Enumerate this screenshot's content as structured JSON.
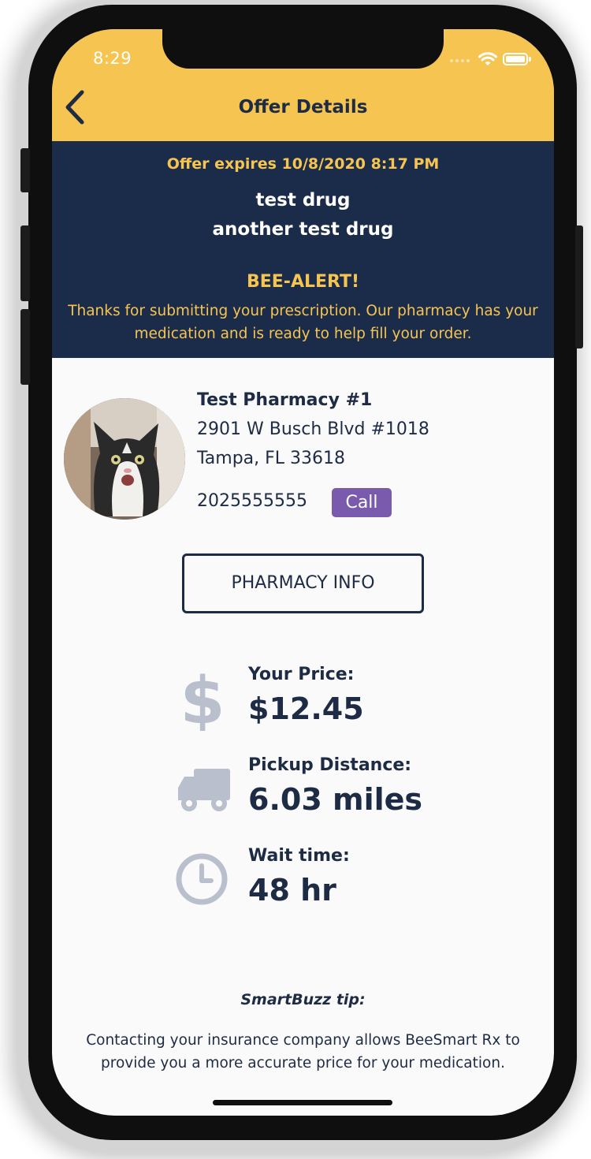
{
  "status_bar": {
    "time": "8:29"
  },
  "header": {
    "title": "Offer Details"
  },
  "alert": {
    "expires": "Offer expires 10/8/2020 8:17 PM",
    "drugs": [
      "test drug",
      "another test drug"
    ],
    "bee_title": "BEE-ALERT!",
    "bee_message": "Thanks for submitting your prescription. Our pharmacy has your medication and is ready to help fill your order."
  },
  "pharmacy": {
    "name": "Test Pharmacy #1",
    "address_line1": "2901 W Busch Blvd #1018",
    "address_line2": "Tampa, FL 33618",
    "phone": "2025555555",
    "call_label": "Call",
    "info_button": "PHARMACY INFO"
  },
  "stats": {
    "price_label": "Your Price:",
    "price_value": "$12.45",
    "distance_label": "Pickup Distance:",
    "distance_value": "6.03 miles",
    "wait_label": "Wait time:",
    "wait_value": "48 hr",
    "icon_color": "#b9bfcc"
  },
  "tip": {
    "title": "SmartBuzz tip:",
    "body": "Contacting your insurance company allows BeeSmart Rx to provide you a more accurate price for your medication."
  },
  "colors": {
    "header": "#f6c451",
    "banner": "#1a2c4a",
    "accent": "#f6c451",
    "text": "#1e2b44",
    "call": "#7a5aad"
  }
}
